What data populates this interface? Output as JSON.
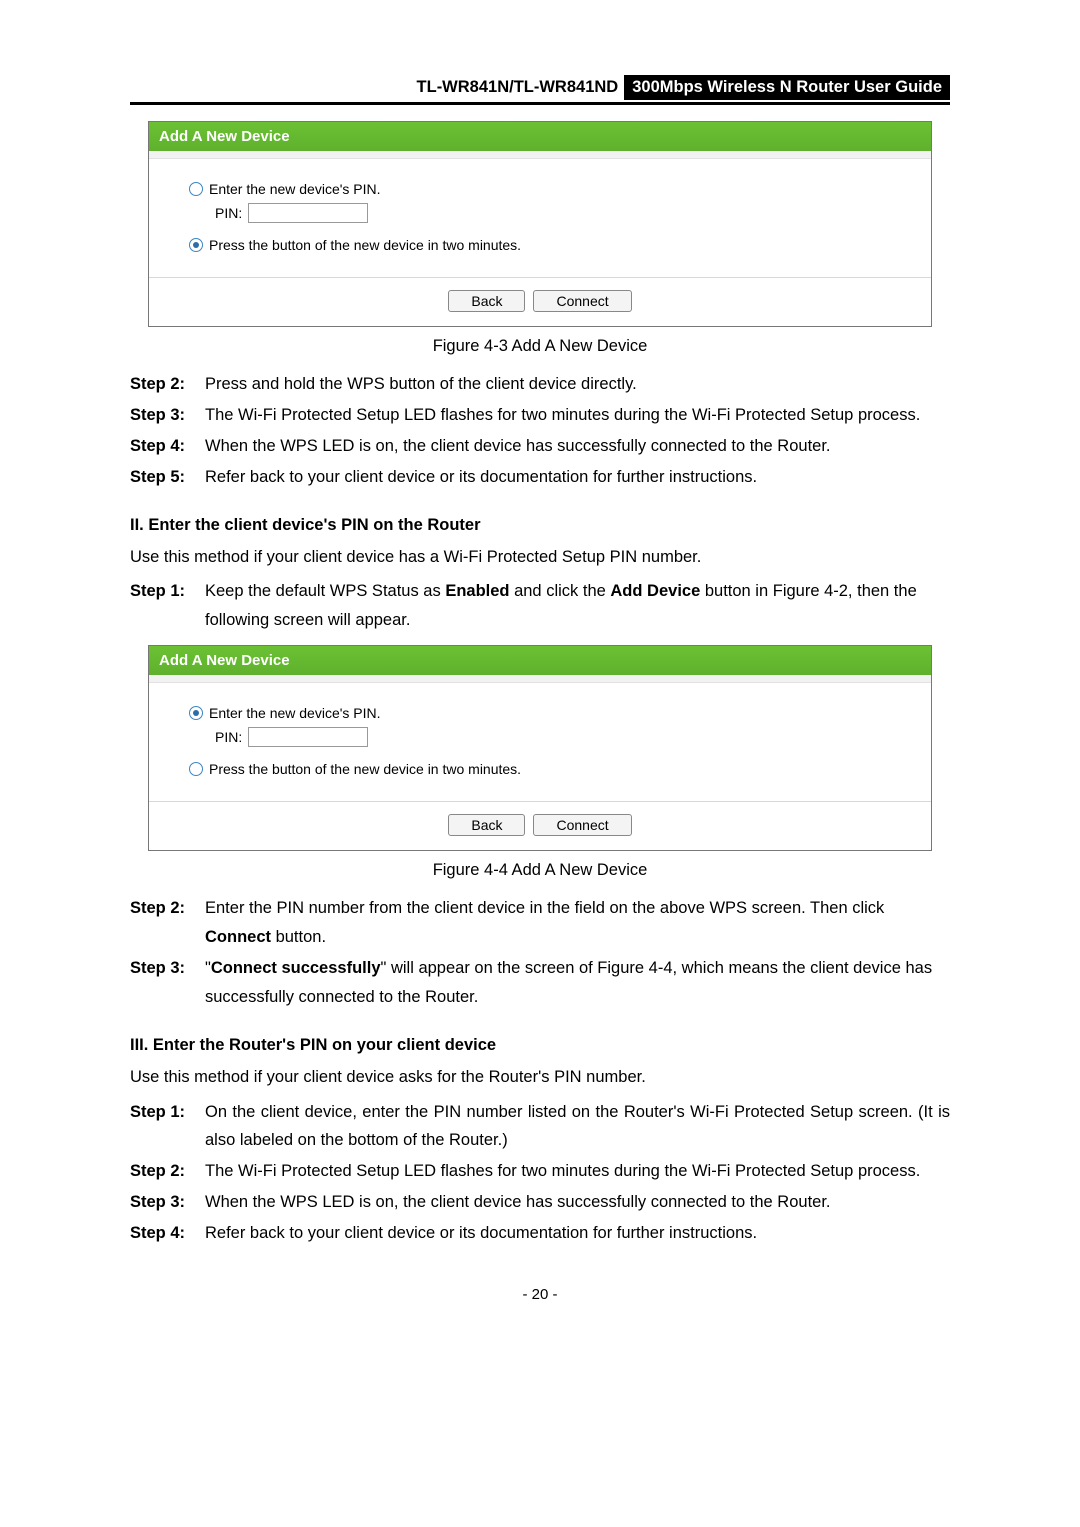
{
  "header": {
    "left": "TL-WR841N/TL-WR841ND",
    "right": "300Mbps Wireless N Router User Guide"
  },
  "dialog1": {
    "title": "Add A New Device",
    "opt1": "Enter the new device's PIN.",
    "pin_label": "PIN:",
    "opt2": "Press the button of the new device in two minutes.",
    "back": "Back",
    "connect": "Connect"
  },
  "caption1": "Figure 4-3 Add A New Device",
  "stepsA": {
    "s2_label": "Step 2:",
    "s2": "Press and hold the WPS button of the client device directly.",
    "s3_label": "Step 3:",
    "s3": "The Wi-Fi Protected Setup LED flashes for two minutes during the Wi-Fi Protected Setup process.",
    "s4_label": "Step 4:",
    "s4": "When the WPS LED is on, the client device has successfully connected to the Router.",
    "s5_label": "Step 5:",
    "s5": "Refer back to your client device or its documentation for further instructions."
  },
  "section2": "II.  Enter the client device's PIN on the Router",
  "para2": "Use this method if your client device has a Wi-Fi Protected Setup PIN number.",
  "stepB": {
    "s1_label": "Step 1:",
    "s1_pre": "Keep the default WPS Status as ",
    "s1_b1": "Enabled",
    "s1_mid": " and click the ",
    "s1_b2": "Add Device",
    "s1_post": " button in Figure 4-2, then the following screen will appear."
  },
  "dialog2": {
    "title": "Add A New Device",
    "opt1": "Enter the new device's PIN.",
    "pin_label": "PIN:",
    "opt2": "Press the button of the new device in two minutes.",
    "back": "Back",
    "connect": "Connect"
  },
  "caption2": "Figure 4-4   Add A New Device",
  "stepsC": {
    "s2_label": "Step 2:",
    "s2_pre": "Enter the PIN number from the client device in the field on the above WPS screen. Then click ",
    "s2_b": "Connect",
    "s2_post": " button.",
    "s3_label": "Step 3:",
    "s3_pre": "\"",
    "s3_b": "Connect successfully",
    "s3_post": "\" will appear on the screen of Figure 4-4, which means the client device has successfully connected to the Router."
  },
  "section3": "III.  Enter the Router's PIN on your client device",
  "para3": "Use this method if your client device asks for the Router's PIN number.",
  "stepsD": {
    "s1_label": "Step 1:",
    "s1": "On the client device, enter the PIN number listed on the Router's Wi-Fi Protected Setup screen. (It is also labeled on the bottom of the Router.)",
    "s2_label": "Step 2:",
    "s2": "The Wi-Fi Protected Setup LED flashes for two minutes during the Wi-Fi Protected Setup process.",
    "s3_label": "Step 3:",
    "s3": "When the WPS LED is on, the client device has successfully connected to the Router.",
    "s4_label": "Step 4:",
    "s4": "Refer back to your client device or its documentation for further instructions."
  },
  "page_num": "- 20 -"
}
